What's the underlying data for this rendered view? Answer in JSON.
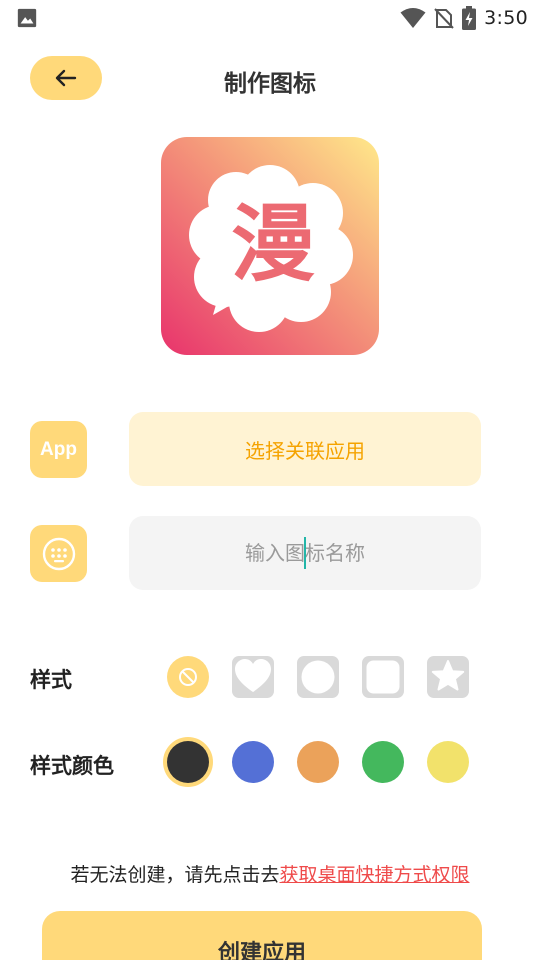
{
  "status_bar": {
    "time": "3:50",
    "left_icon": "image-icon",
    "right_icons": [
      "wifi-icon",
      "no-sim-icon",
      "battery-charging-icon"
    ]
  },
  "header": {
    "back_icon": "arrow-left-icon",
    "title": "制作图标"
  },
  "preview": {
    "glyph": "漫",
    "gradient": [
      "#ffe98a",
      "#e8336c"
    ]
  },
  "app_row": {
    "icon_text": "App",
    "button_label": "选择关联应用"
  },
  "name_row": {
    "icon": "keyboard-icon",
    "placeholder": "输入图标名称"
  },
  "style": {
    "label": "样式",
    "options": [
      "none-icon",
      "heart-shape-icon",
      "circle-shape-icon",
      "rounded-square-icon",
      "star-shape-icon"
    ],
    "selected": "none-icon"
  },
  "style_color": {
    "label": "样式颜色",
    "colors": [
      "#333333",
      "#5470d6",
      "#eba25a",
      "#44b85d",
      "#f2e26b"
    ],
    "selected": "#333333"
  },
  "footer": {
    "notice_prefix": "若无法创建，请先点击去",
    "notice_link": "获取桌面快捷方式权限",
    "create_label": "创建应用"
  },
  "colors": {
    "accent": "#ffd97a",
    "link": "#ef4a4a",
    "app_button_text": "#f5a300"
  }
}
